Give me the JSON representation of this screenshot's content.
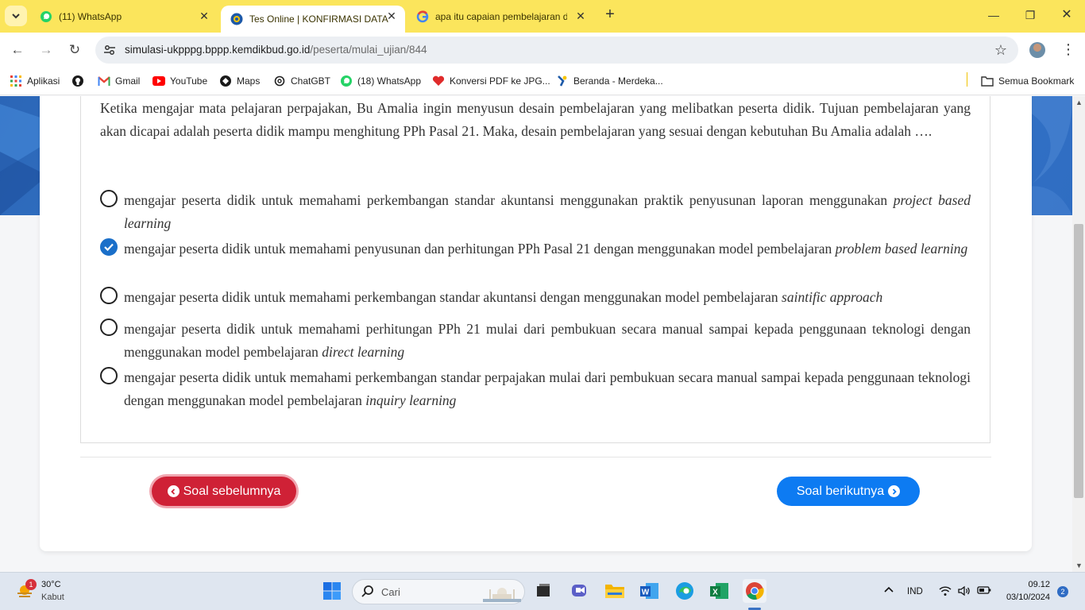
{
  "browser": {
    "tabs": [
      {
        "title": "(11) WhatsApp",
        "icon": "whatsapp-icon",
        "active": false
      },
      {
        "title": "Tes Online | KONFIRMASI DATA",
        "icon": "kemdikbud-icon",
        "active": true
      },
      {
        "title": "apa itu capaian pembelajaran d",
        "icon": "google-icon",
        "active": false
      }
    ],
    "new_tab_label": "+",
    "url_domain": "simulasi-ukpppg.bppp.kemdikbud.go.id",
    "url_path": "/peserta/mulai_ujian/844"
  },
  "bookmarks": {
    "items": [
      {
        "label": "Aplikasi",
        "icon": "apps-grid-icon"
      },
      {
        "label": "",
        "icon": "github-icon"
      },
      {
        "label": "Gmail",
        "icon": "gmail-icon"
      },
      {
        "label": "YouTube",
        "icon": "youtube-icon"
      },
      {
        "label": "Maps",
        "icon": "maps-icon"
      },
      {
        "label": "ChatGBT",
        "icon": "chatgpt-icon"
      },
      {
        "label": "(18) WhatsApp",
        "icon": "whatsapp-icon"
      },
      {
        "label": "Konversi PDF ke JPG...",
        "icon": "heart-icon"
      },
      {
        "label": "Beranda - Merdeka...",
        "icon": "merdeka-icon"
      }
    ],
    "all_bookmarks_label": "Semua Bookmark"
  },
  "exam": {
    "question": "Ketika mengajar mata pelajaran perpajakan, Bu Amalia ingin menyusun desain pembelajaran yang melibatkan peserta didik. Tujuan pembelajaran yang akan dicapai adalah peserta didik mampu menghitung PPh Pasal 21. Maka, desain pembelajaran yang sesuai dengan kebutuhan Bu Amalia adalah ….",
    "options": [
      {
        "text": "mengajar peserta didik untuk memahami perkembangan standar akuntansi menggunakan praktik penyusunan laporan menggunakan ",
        "italic": "project based learning",
        "checked": false
      },
      {
        "text": "mengajar peserta didik untuk memahami penyusunan dan perhitungan PPh Pasal 21 dengan menggunakan model pembelajaran ",
        "italic": "problem based learning",
        "checked": true
      },
      {
        "text": "mengajar peserta didik untuk memahami perkembangan standar akuntansi dengan menggunakan model pembelajaran ",
        "italic": "saintific approach",
        "checked": false
      },
      {
        "text": "mengajar peserta didik untuk memahami perhitungan PPh 21 mulai dari pembukuan secara manual sampai kepada penggunaan teknologi dengan menggunakan model pembelajaran ",
        "italic": "direct learning",
        "checked": false
      },
      {
        "text": "mengajar peserta didik untuk memahami perkembangan standar perpajakan mulai dari pembukuan secara manual sampai kepada penggunaan teknologi dengan menggunakan model pembelajaran ",
        "italic": "inquiry learning",
        "checked": false
      }
    ],
    "prev_label": "Soal sebelumnya",
    "next_label": "Soal berikutnya"
  },
  "taskbar": {
    "weather_temp": "30°C",
    "weather_desc": "Kabut",
    "weather_badge": "1",
    "search_placeholder": "Cari",
    "language": "IND",
    "time": "09.12",
    "date": "03/10/2024",
    "notification_count": "2"
  },
  "colors": {
    "tabstrip": "#fbe55c",
    "banner": "#2f6dc2",
    "prev_button": "#cf2136",
    "next_button": "#0d7bf2",
    "radio_checked": "#1a6fc9"
  }
}
